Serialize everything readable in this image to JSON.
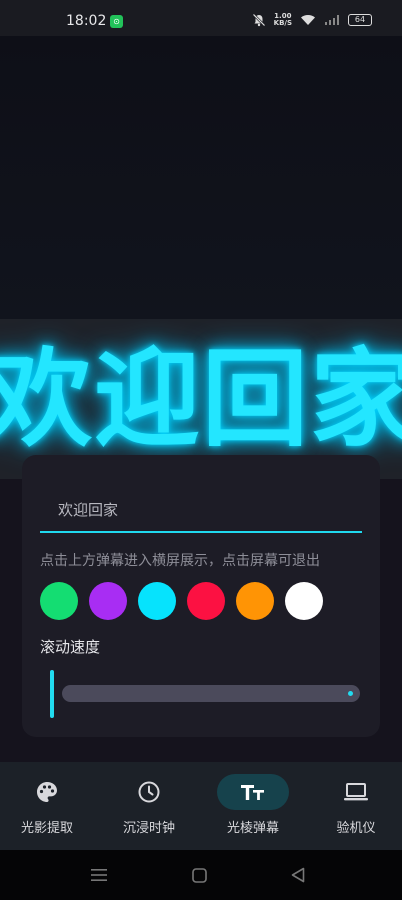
{
  "status_bar": {
    "time": "18:02",
    "app_icon_glyph": "⊙",
    "speed_value": "1.00",
    "speed_unit": "KB/S",
    "battery": "64"
  },
  "banner": {
    "text": "欢迎回家",
    "color": "#23e6ff"
  },
  "card": {
    "input_value": "欢迎回家",
    "hint": "点击上方弹幕进入横屏展示，点击屏幕可退出",
    "colors": [
      "#14dd72",
      "#a82df3",
      "#06e3fd",
      "#fc1142",
      "#ff9405",
      "#ffffff"
    ],
    "speed_label": "滚动速度",
    "speed_fraction": 0.0
  },
  "nav": {
    "items": [
      {
        "label": "光影提取",
        "icon": "palette-icon"
      },
      {
        "label": "沉浸时钟",
        "icon": "clock-icon"
      },
      {
        "label": "光棱弹幕",
        "icon": "text-size-icon",
        "active": true
      },
      {
        "label": "验机仪",
        "icon": "laptop-icon"
      }
    ]
  },
  "system_nav": {
    "icons": [
      "menu-icon",
      "home-icon",
      "back-icon"
    ]
  }
}
